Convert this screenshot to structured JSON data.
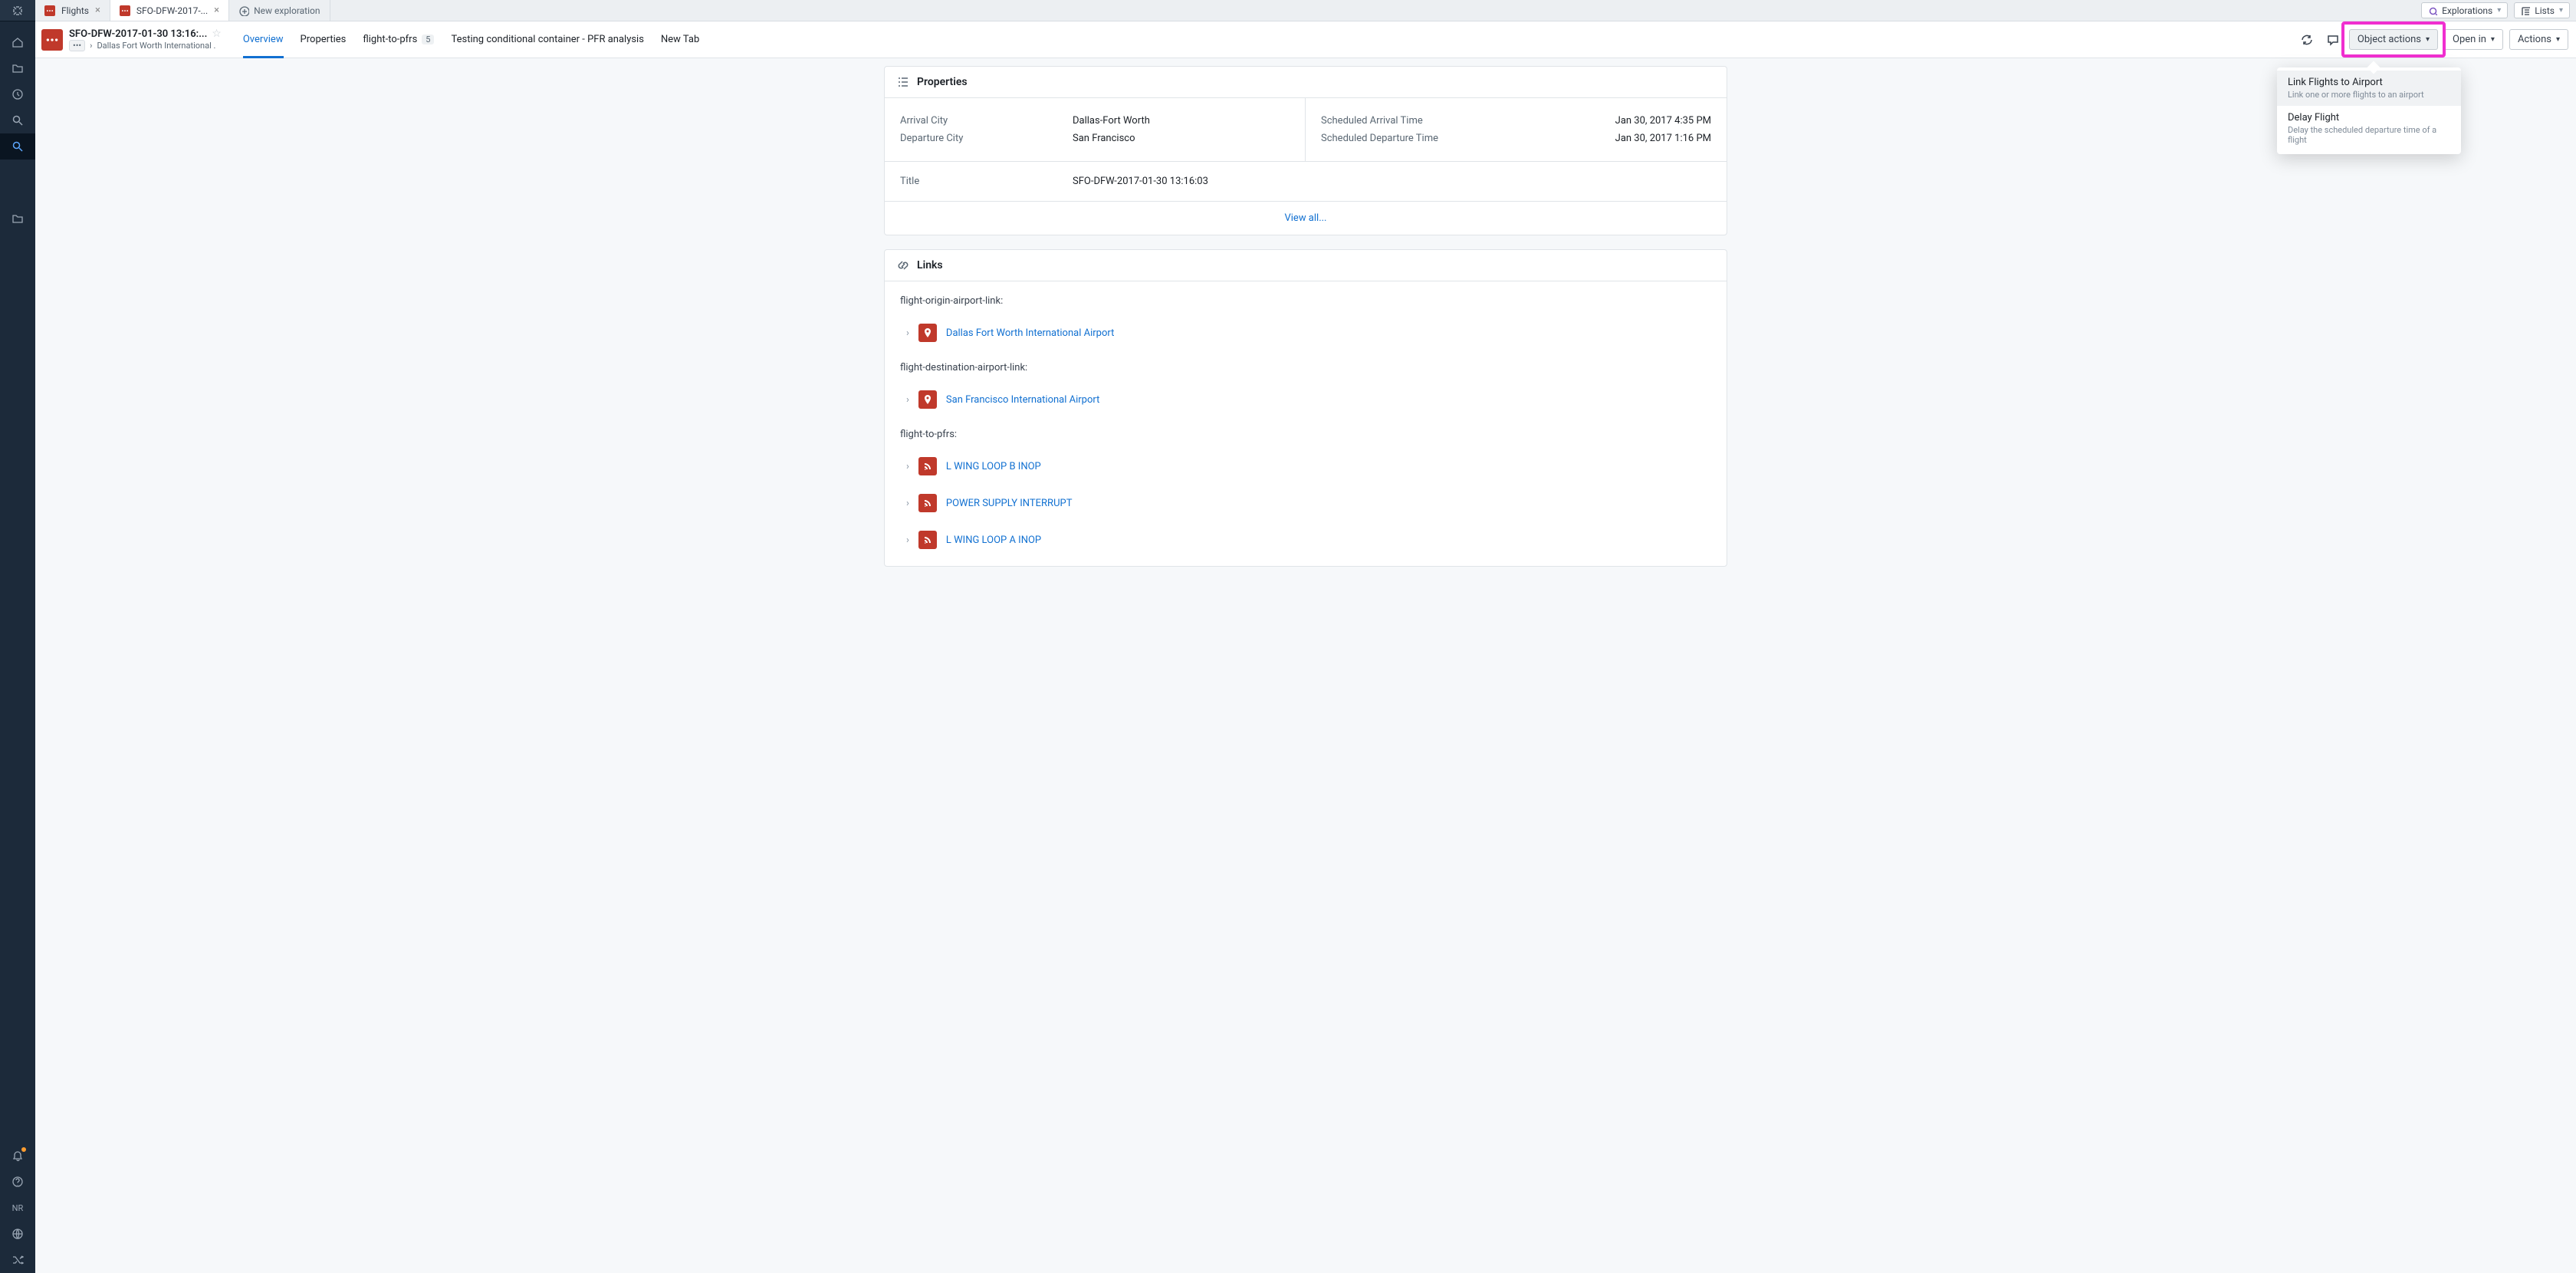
{
  "tabs": {
    "flights": "Flights",
    "current": "SFO-DFW-2017-...",
    "new_exploration": "New exploration"
  },
  "top_buttons": {
    "explorations": "Explorations",
    "lists": "Lists"
  },
  "object": {
    "title": "SFO-DFW-2017-01-30 13:16:...",
    "breadcrumb_chip": "•••",
    "breadcrumb": "Dallas Fort Worth International ."
  },
  "midtabs": {
    "overview": "Overview",
    "properties": "Properties",
    "flight_to_pfrs": "flight-to-pfrs",
    "flight_to_pfrs_count": "5",
    "testing": "Testing conditional container - PFR analysis",
    "new_tab": "New Tab"
  },
  "header_buttons": {
    "object_actions": "Object actions",
    "open_in": "Open in",
    "actions": "Actions"
  },
  "dropdown": {
    "link_flights_title": "Link Flights to Airport",
    "link_flights_sub": "Link one or more flights to an airport",
    "delay_flight_title": "Delay Flight",
    "delay_flight_sub": "Delay the scheduled departure time of a flight"
  },
  "properties_card": {
    "heading": "Properties",
    "left": [
      {
        "label": "Arrival City",
        "value": "Dallas-Fort Worth"
      },
      {
        "label": "Departure City",
        "value": "San Francisco"
      }
    ],
    "right": [
      {
        "label": "Scheduled Arrival Time",
        "value": "Jan 30, 2017 4:35 PM"
      },
      {
        "label": "Scheduled Departure Time",
        "value": "Jan 30, 2017 1:16 PM"
      }
    ],
    "title_label": "Title",
    "title_value": "SFO-DFW-2017-01-30 13:16:03",
    "view_all": "View all..."
  },
  "links_card": {
    "heading": "Links",
    "groups": [
      {
        "label": "flight-origin-airport-link:",
        "type": "pin",
        "items": [
          "Dallas Fort Worth International Airport"
        ]
      },
      {
        "label": "flight-destination-airport-link:",
        "type": "pin",
        "items": [
          "San Francisco International Airport"
        ]
      },
      {
        "label": "flight-to-pfrs:",
        "type": "rss",
        "items": [
          "L WING LOOP B INOP",
          "POWER SUPPLY INTERRUPT",
          "L WING LOOP A INOP"
        ]
      }
    ]
  },
  "rail_nr": "NR"
}
